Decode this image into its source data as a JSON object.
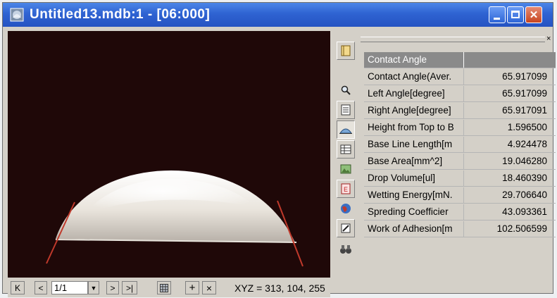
{
  "window": {
    "title": "Untitled13.mdb:1 - [06:000]",
    "app_icon": "app-icon",
    "minimize_icon": "minimize-icon",
    "maximize_icon": "maximize-icon",
    "close_icon": "close-icon"
  },
  "viewer": {
    "image_description_icon": "droplet-image",
    "statusbar": {
      "first_label": "K",
      "prev_label": "<",
      "frame_value": "1/1",
      "next_label": ">",
      "last_label": ">|",
      "grid_icon": "grid-icon",
      "plus_label": "+",
      "x_label": "×",
      "xyz_readout": "XYZ = 313, 104, 255"
    }
  },
  "toolbar": {
    "items": [
      {
        "icon": "notebook-icon"
      },
      {
        "icon": "blank-icon"
      },
      {
        "icon": "magnifier-icon"
      },
      {
        "icon": "document-icon"
      },
      {
        "icon": "droplet-profile-icon"
      },
      {
        "icon": "table-icon"
      },
      {
        "icon": "image-icon"
      },
      {
        "icon": "report-icon"
      },
      {
        "icon": "globe-icon"
      },
      {
        "icon": "pen-icon"
      },
      {
        "icon": "binoculars-icon"
      }
    ]
  },
  "results": {
    "close_label": "×",
    "header": {
      "name": "Contact Angle",
      "value": ""
    },
    "rows": [
      {
        "name": "Contact Angle(Aver.",
        "value": "65.917099"
      },
      {
        "name": "Left Angle[degree]",
        "value": "65.917099"
      },
      {
        "name": "Right Angle[degree]",
        "value": "65.917091"
      },
      {
        "name": "Height from Top to B",
        "value": "1.596500"
      },
      {
        "name": "Base Line Length[m",
        "value": "4.924478"
      },
      {
        "name": "Base Area[mm^2]",
        "value": "19.046280"
      },
      {
        "name": "Drop Volume[ul]",
        "value": "18.460390"
      },
      {
        "name": "Wetting Energy[mN.",
        "value": "29.706640"
      },
      {
        "name": "Spreding Coefficier",
        "value": "43.093361"
      },
      {
        "name": "Work of Adhesion[m",
        "value": "102.506599"
      }
    ]
  },
  "colors": {
    "titlebar": "#2f63d2",
    "image_background": "#1f0808",
    "tangent_lines": "#c0392b",
    "table_header": "#8a8a8a"
  }
}
